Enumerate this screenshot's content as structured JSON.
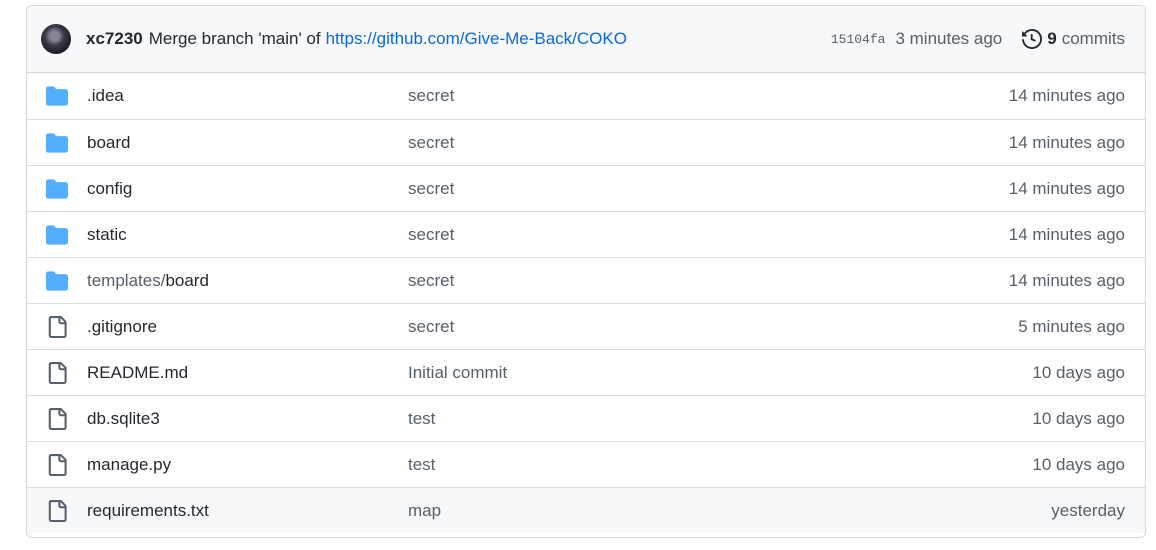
{
  "commit": {
    "author": "xc7230",
    "message": "Merge branch 'main' of",
    "link": "https://github.com/Give-Me-Back/COKO",
    "sha": "15104fa",
    "time": "3 minutes ago",
    "commit_count": "9",
    "commits_label": "commits"
  },
  "files": [
    {
      "type": "folder",
      "name": ".idea",
      "message": "secret",
      "time": "14 minutes ago"
    },
    {
      "type": "folder",
      "name": "board",
      "message": "secret",
      "time": "14 minutes ago"
    },
    {
      "type": "folder",
      "name": "config",
      "message": "secret",
      "time": "14 minutes ago"
    },
    {
      "type": "folder",
      "name": "static",
      "message": "secret",
      "time": "14 minutes ago"
    },
    {
      "type": "folder",
      "name_dir": "templates/",
      "name": "board",
      "message": "secret",
      "time": "14 minutes ago"
    },
    {
      "type": "file",
      "name": ".gitignore",
      "message": "secret",
      "time": "5 minutes ago"
    },
    {
      "type": "file",
      "name": "README.md",
      "message": "Initial commit",
      "time": "10 days ago"
    },
    {
      "type": "file",
      "name": "db.sqlite3",
      "message": "test",
      "time": "10 days ago"
    },
    {
      "type": "file",
      "name": "manage.py",
      "message": "test",
      "time": "10 days ago"
    },
    {
      "type": "file",
      "name": "requirements.txt",
      "message": "map",
      "time": "yesterday"
    }
  ],
  "colors": {
    "folder": "#54aeff",
    "link": "#0969da"
  }
}
